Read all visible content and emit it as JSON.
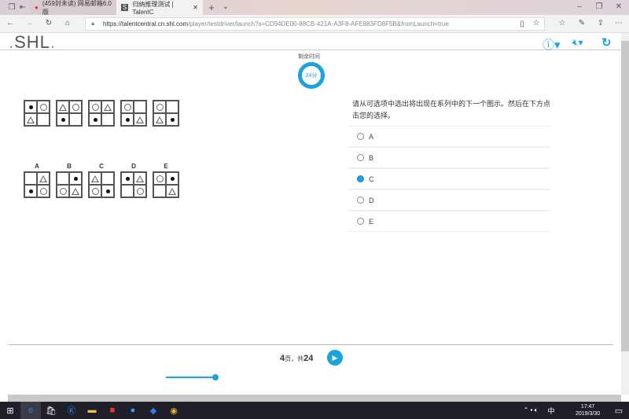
{
  "browser": {
    "tabs": [
      {
        "label": "(459封未读) 网易邮箱6.0版"
      },
      {
        "label": "归纳推理测试 | TalentC"
      }
    ],
    "url_host": "https://talentcentral.cn.shl.com",
    "url_path": "/player/testdriver/launch?s=CD94DE00-88CB-421A-A3F8-AFE883FD8F5B&fromLaunch=true"
  },
  "app": {
    "logo": "SHL",
    "logo_dot": ".",
    "timer_label": "剩余时间",
    "timer_value": "24分",
    "accent": "#1aa3dd"
  },
  "sequence": [
    [
      "dot",
      "circle",
      "triangle",
      ""
    ],
    [
      "triangle",
      "circle",
      "dot",
      ""
    ],
    [
      "circle",
      "triangle",
      "dot",
      ""
    ],
    [
      "circle",
      "",
      "dot",
      "triangle"
    ],
    [
      "circle",
      "",
      "triangle",
      "dot"
    ]
  ],
  "answers": [
    {
      "label": "A",
      "cells": [
        "",
        "triangle",
        "dot",
        "circle"
      ]
    },
    {
      "label": "B",
      "cells": [
        "",
        "dot",
        "circle",
        "triangle"
      ]
    },
    {
      "label": "C",
      "cells": [
        "triangle",
        "",
        "circle",
        "dot"
      ]
    },
    {
      "label": "D",
      "cells": [
        "dot",
        "triangle",
        "",
        "circle"
      ]
    },
    {
      "label": "E",
      "cells": [
        "circle",
        "dot",
        "",
        "triangle"
      ]
    }
  ],
  "question": "请从可选项中选出将出现在系列中的下一个图示。然后在下方点击您的选择。",
  "options": [
    {
      "label": "A",
      "selected": false
    },
    {
      "label": "B",
      "selected": false
    },
    {
      "label": "C",
      "selected": true
    },
    {
      "label": "D",
      "selected": false
    },
    {
      "label": "E",
      "selected": false
    }
  ],
  "pager": {
    "current": "4",
    "sep": "页，共",
    "total": "24"
  },
  "progress": {
    "value": 4,
    "max": 24
  },
  "taskbar": {
    "ime": "中",
    "time": "17:47",
    "date": "2019/3/30"
  }
}
